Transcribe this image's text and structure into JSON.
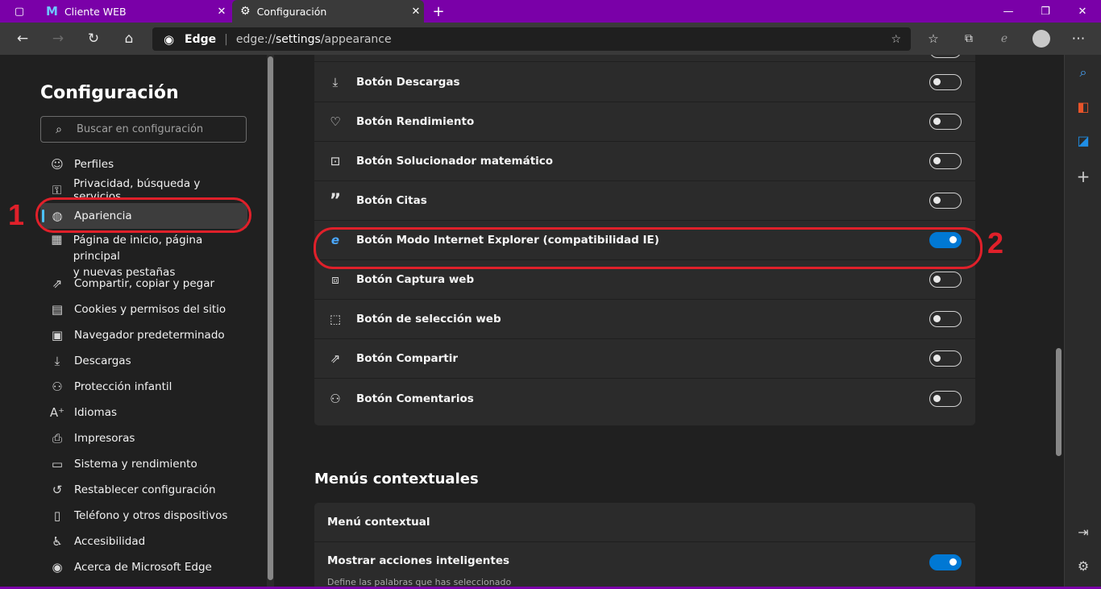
{
  "tabs": [
    {
      "label": "Cliente WEB",
      "icon": "m-logo-icon"
    },
    {
      "label": "Configuración",
      "icon": "gear-icon",
      "active": true
    }
  ],
  "address": {
    "brand": "Edge",
    "url_prefix": "edge://",
    "url_host": "settings",
    "url_path": "/appearance"
  },
  "sidebar": {
    "title": "Configuración",
    "search_placeholder": "Buscar en configuración",
    "items": [
      {
        "label": "Perfiles",
        "icon": "profile-icon"
      },
      {
        "label": "Privacidad, búsqueda y servicios",
        "icon": "lock-icon"
      },
      {
        "label": "Apariencia",
        "icon": "palette-icon",
        "active": true
      },
      {
        "label": "Página de inicio, página principal",
        "label2": "y nuevas pestañas",
        "icon": "home-grid-icon"
      },
      {
        "label": "Compartir, copiar y pegar",
        "icon": "share-icon"
      },
      {
        "label": "Cookies y permisos del sitio",
        "icon": "cookie-icon"
      },
      {
        "label": "Navegador predeterminado",
        "icon": "browser-icon"
      },
      {
        "label": "Descargas",
        "icon": "download-icon"
      },
      {
        "label": "Protección infantil",
        "icon": "family-icon"
      },
      {
        "label": "Idiomas",
        "icon": "language-icon"
      },
      {
        "label": "Impresoras",
        "icon": "printer-icon"
      },
      {
        "label": "Sistema y rendimiento",
        "icon": "laptop-icon"
      },
      {
        "label": "Restablecer configuración",
        "icon": "reset-icon"
      },
      {
        "label": "Teléfono y otros dispositivos",
        "icon": "phone-icon"
      },
      {
        "label": "Accesibilidad",
        "icon": "accessibility-icon"
      },
      {
        "label": "Acerca de Microsoft Edge",
        "icon": "edge-icon"
      }
    ]
  },
  "toolbar_buttons": [
    {
      "label": "Botón Descargas",
      "icon": "download-icon",
      "on": false
    },
    {
      "label": "Botón Rendimiento",
      "icon": "heartbeat-icon",
      "on": false
    },
    {
      "label": "Botón Solucionador matemático",
      "icon": "math-icon",
      "on": false
    },
    {
      "label": "Botón Citas",
      "icon": "quote-icon",
      "on": false
    },
    {
      "label": "Botón Modo Internet Explorer (compatibilidad IE)",
      "icon": "ie-icon",
      "on": true
    },
    {
      "label": "Botón Captura web",
      "icon": "screenshot-icon",
      "on": false
    },
    {
      "label": "Botón de selección web",
      "icon": "selection-icon",
      "on": false
    },
    {
      "label": "Botón Compartir",
      "icon": "share-icon",
      "on": false
    },
    {
      "label": "Botón Comentarios",
      "icon": "feedback-icon",
      "on": false
    }
  ],
  "context_menus": {
    "section_title": "Menús contextuales",
    "card_header": "Menú contextual",
    "smart_actions_label": "Mostrar acciones inteligentes",
    "smart_actions_on": true,
    "smart_actions_desc": "Define las palabras que has seleccionado"
  },
  "annotations": {
    "num1": "1",
    "num2": "2",
    "color": "#e0202a"
  },
  "colors": {
    "accent": "#0078d4",
    "titlebar": "#7a00a8"
  }
}
